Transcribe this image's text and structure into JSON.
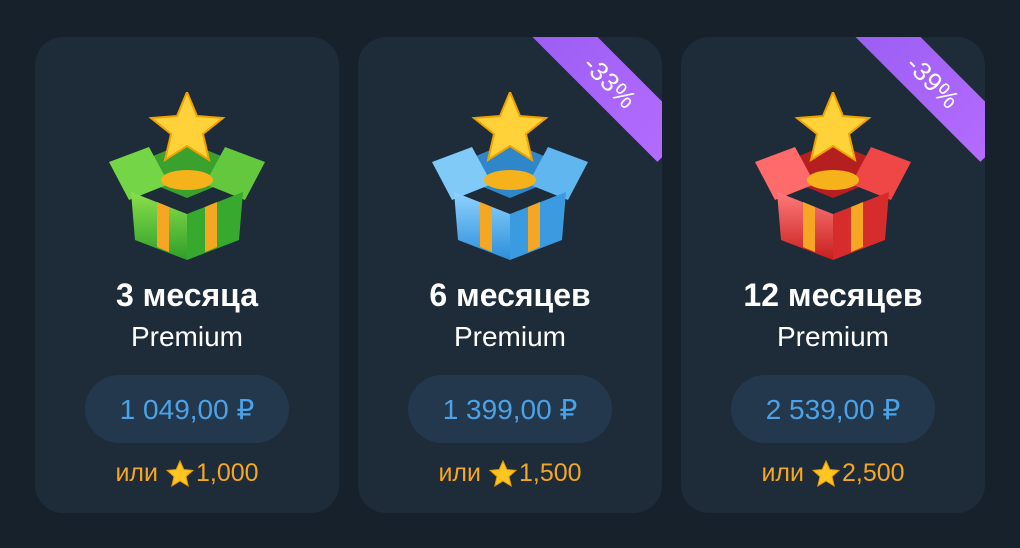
{
  "cards": [
    {
      "title": "3 месяца",
      "subtitle": "Premium",
      "price": "1 049,00 ₽",
      "or_label": "или",
      "stars": "1,000",
      "discount": "",
      "gift_color": "#5dc73b",
      "gift_icon": "green-gift-box-icon"
    },
    {
      "title": "6 месяцев",
      "subtitle": "Premium",
      "price": "1 399,00 ₽",
      "or_label": "или",
      "stars": "1,500",
      "discount": "-33%",
      "gift_color": "#4fb0ee",
      "gift_icon": "blue-gift-box-icon"
    },
    {
      "title": "12 месяцев",
      "subtitle": "Premium",
      "price": "2 539,00 ₽",
      "or_label": "или",
      "stars": "2,500",
      "discount": "-39%",
      "gift_color": "#ee3b3b",
      "gift_icon": "red-gift-box-icon"
    }
  ],
  "colors": {
    "background": "#17212b",
    "card": "#1e2b38",
    "price_button": "#24384d",
    "price_text": "#4aa2e8",
    "stars_text": "#f5a623",
    "ribbon": "#a962f8"
  }
}
